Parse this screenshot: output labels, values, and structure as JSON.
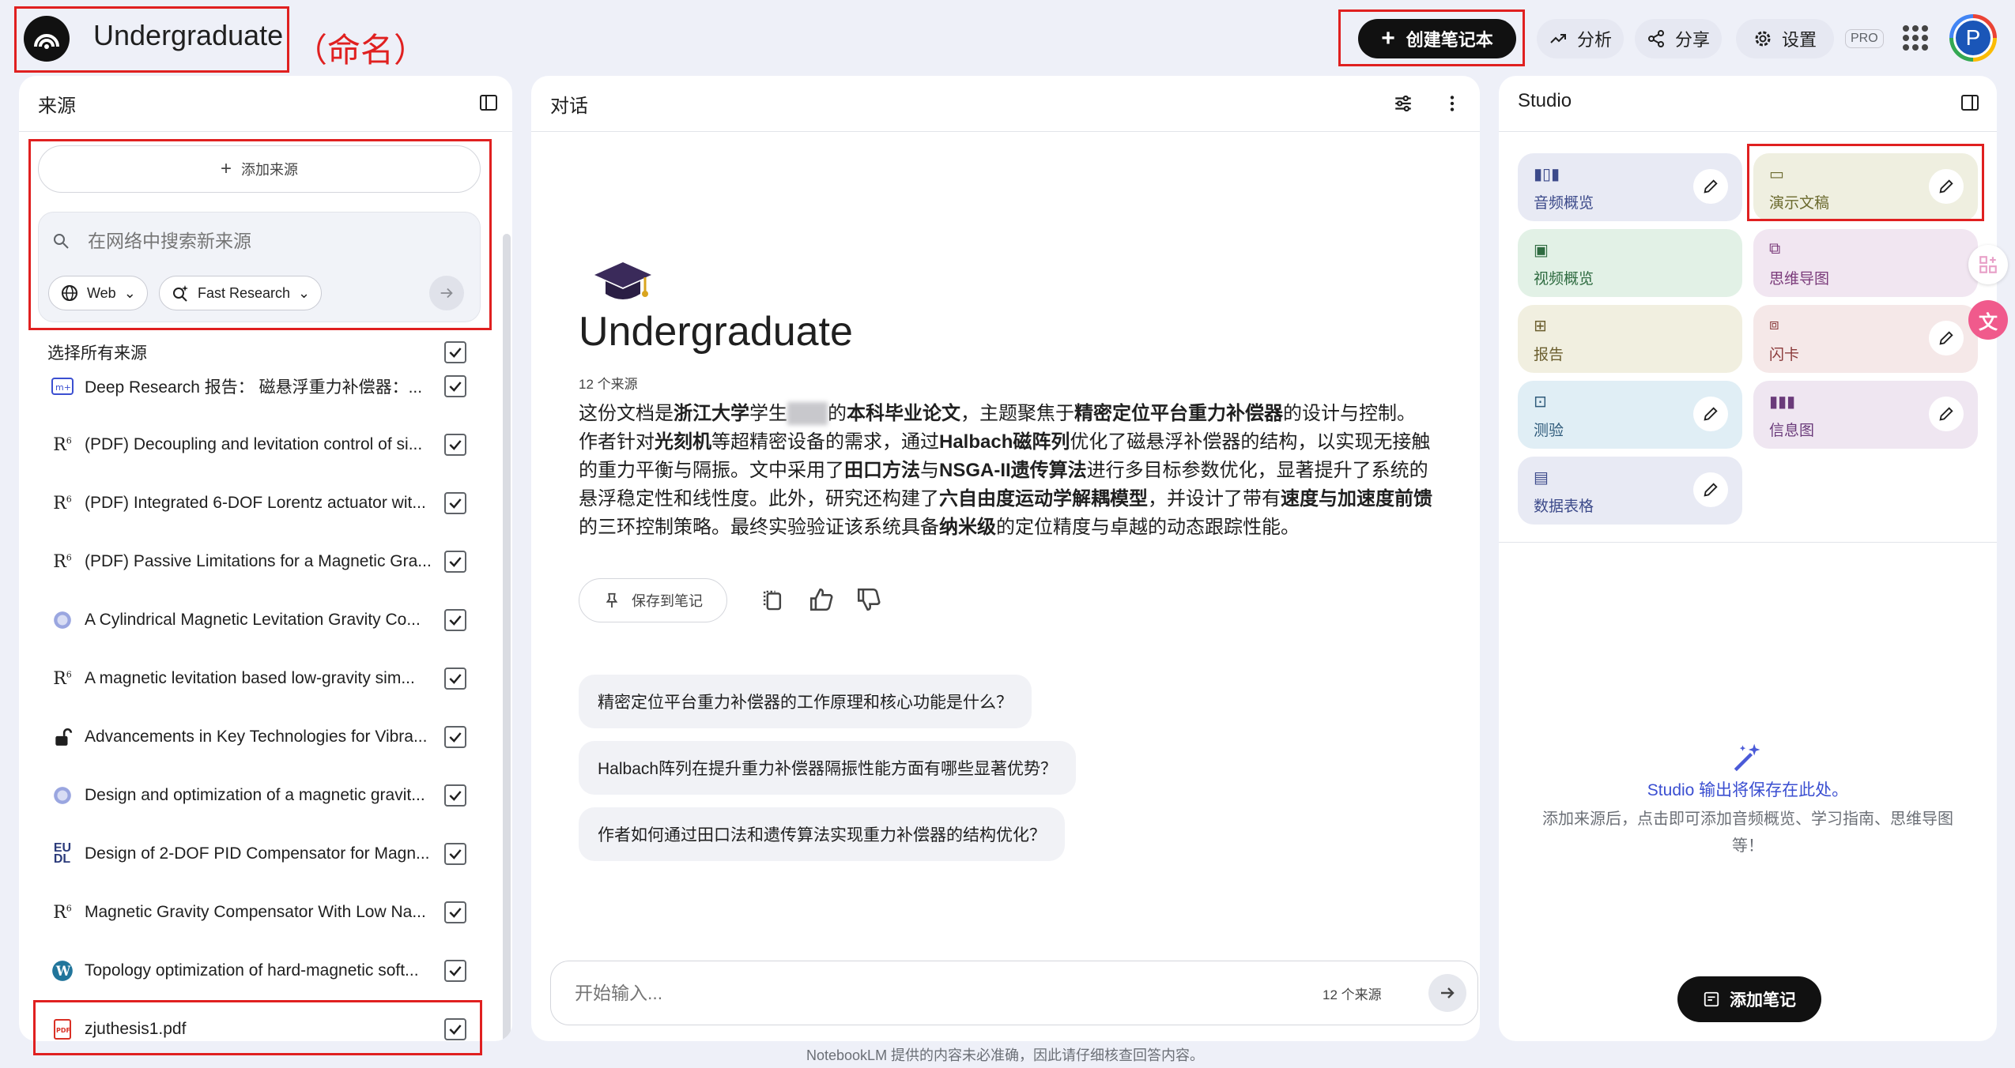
{
  "header": {
    "notebook_title": "Undergraduate",
    "annotation": "（命名）",
    "create_notebook": "创建笔记本",
    "analytics": "分析",
    "share": "分享",
    "settings": "设置",
    "pro_badge": "PRO",
    "avatar_initial": "P"
  },
  "sources": {
    "title": "来源",
    "add_source": "添加来源",
    "search_placeholder": "在网络中搜索新来源",
    "web_pill": "Web",
    "research_pill": "Fast Research",
    "select_all": "选择所有来源",
    "items": [
      {
        "label": "Deep Research 报告： 磁悬浮重力补偿器：...",
        "icon": "deep-research-icon"
      },
      {
        "label": "(PDF) Decoupling and levitation control of si...",
        "icon": "researchgate-icon"
      },
      {
        "label": "(PDF) Integrated 6-DOF Lorentz actuator wit...",
        "icon": "researchgate-icon"
      },
      {
        "label": "(PDF) Passive Limitations for a Magnetic Gra...",
        "icon": "researchgate-icon"
      },
      {
        "label": "A Cylindrical Magnetic Levitation Gravity Co...",
        "icon": "globe-icon"
      },
      {
        "label": "A magnetic levitation based low-gravity sim...",
        "icon": "researchgate-icon"
      },
      {
        "label": "Advancements in Key Technologies for Vibra...",
        "icon": "lock-icon"
      },
      {
        "label": "Design and optimization of a magnetic gravit...",
        "icon": "globe-icon"
      },
      {
        "label": "Design of 2-DOF PID Compensator for Magn...",
        "icon": "eudl-icon"
      },
      {
        "label": "Magnetic Gravity Compensator With Low Na...",
        "icon": "researchgate-icon"
      },
      {
        "label": "Topology optimization of hard-magnetic soft...",
        "icon": "wordpress-icon"
      },
      {
        "label": "zjuthesis1.pdf",
        "icon": "pdf-icon"
      }
    ]
  },
  "chat": {
    "title": "对话",
    "notebook_title": "Undergraduate",
    "source_count": "12 个来源",
    "summary_html_parts": [
      {
        "t": "这份文档是",
        "b": false
      },
      {
        "t": "浙江大学",
        "b": true
      },
      {
        "t": "学生",
        "b": false
      },
      {
        "t": "███",
        "b": false,
        "blur": true
      },
      {
        "t": "的",
        "b": false
      },
      {
        "t": "本科毕业论文",
        "b": true
      },
      {
        "t": "，主题聚焦于",
        "b": false
      },
      {
        "t": "精密定位平台重力补偿器",
        "b": true
      },
      {
        "t": "的设计与控制。作者针对",
        "b": false
      },
      {
        "t": "光刻机",
        "b": true
      },
      {
        "t": "等超精密设备的需求，通过",
        "b": false
      },
      {
        "t": "Halbach磁阵列",
        "b": true
      },
      {
        "t": "优化了磁悬浮补偿器的结构，以实现无接触的重力平衡与隔振。文中采用了",
        "b": false
      },
      {
        "t": "田口方法",
        "b": true
      },
      {
        "t": "与",
        "b": false
      },
      {
        "t": "NSGA-II遗传算法",
        "b": true
      },
      {
        "t": "进行多目标参数优化，显著提升了系统的悬浮稳定性和线性度。此外，研究还构建了",
        "b": false
      },
      {
        "t": "六自由度运动学解耦模型",
        "b": true
      },
      {
        "t": "，并设计了带有",
        "b": false
      },
      {
        "t": "速度与加速度前馈",
        "b": true
      },
      {
        "t": "的三环控制策略。最终实验验证该系统具备",
        "b": false
      },
      {
        "t": "纳米级",
        "b": true
      },
      {
        "t": "的定位精度与卓越的动态跟踪性能。",
        "b": false
      }
    ],
    "save_note": "保存到笔记",
    "suggestions": [
      "精密定位平台重力补偿器的工作原理和核心功能是什么？",
      "Halbach阵列在提升重力补偿器隔振性能方面有哪些显著优势？",
      "作者如何通过田口法和遗传算法实现重力补偿器的结构优化？"
    ],
    "input_placeholder": "开始输入...",
    "input_source_count": "12 个来源"
  },
  "studio": {
    "title": "Studio",
    "tiles": [
      {
        "label": "音频概览",
        "bg": "#e8eaf4",
        "fg": "#3c4a8a",
        "icon": "audio-icon",
        "pen": true
      },
      {
        "label": "演示文稿",
        "bg": "#efefe0",
        "fg": "#6b6a2e",
        "icon": "slides-icon",
        "pen": true
      },
      {
        "label": "视频概览",
        "bg": "#e2f1e6",
        "fg": "#2e6b40",
        "icon": "video-icon",
        "pen": false
      },
      {
        "label": "思维导图",
        "bg": "#f1e6f1",
        "fg": "#7a3a7a",
        "icon": "mindmap-icon",
        "pen": false
      },
      {
        "label": "报告",
        "bg": "#f1efe0",
        "fg": "#6b5e2e",
        "icon": "report-icon",
        "pen": false
      },
      {
        "label": "闪卡",
        "bg": "#f5e8e8",
        "fg": "#8a3a3a",
        "icon": "flashcard-icon",
        "pen": true
      },
      {
        "label": "测验",
        "bg": "#e0eef5",
        "fg": "#2e5a7a",
        "icon": "quiz-icon",
        "pen": true
      },
      {
        "label": "信息图",
        "bg": "#efe6f1",
        "fg": "#6a3a7a",
        "icon": "infographic-icon",
        "pen": true
      },
      {
        "label": "数据表格",
        "bg": "#e8eaf4",
        "fg": "#3c4a8a",
        "icon": "table-icon",
        "pen": true
      }
    ],
    "empty_title": "Studio 输出将保存在此处。",
    "empty_desc_1": "添加来源后，点击即可添加音频概览、学习指南、思维导图",
    "empty_desc_2": "等！",
    "add_note": "添加笔记"
  },
  "footer": "NotebookLM 提供的内容未必准确，因此请仔细核查回答内容。"
}
